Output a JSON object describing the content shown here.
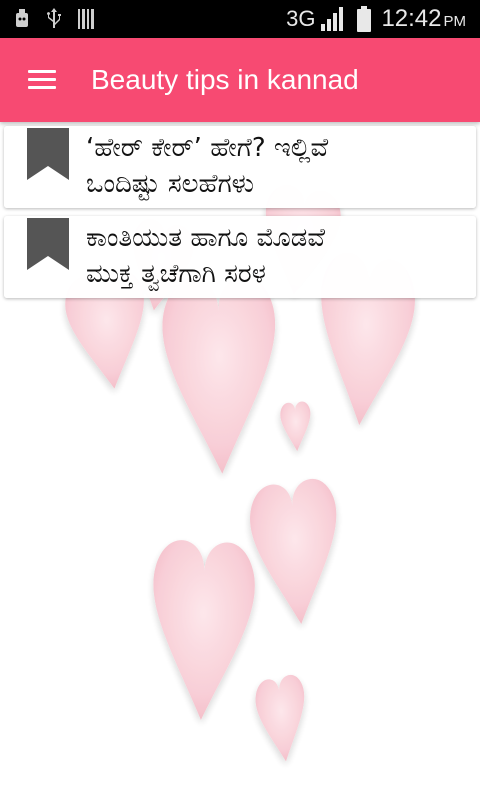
{
  "status_bar": {
    "network": "3G",
    "time": "12:42",
    "ampm": "PM",
    "icons": [
      "robot-notification-icon",
      "usb-icon",
      "barcode-icon",
      "signal-icon",
      "battery-icon"
    ]
  },
  "toolbar": {
    "title": "Beauty tips in kannad",
    "background": "#f74a72"
  },
  "list": {
    "items": [
      {
        "line1": "‘ಹೇರ್ ಕೇರ್’ ಹೇಗೆ? ಇಲ್ಲಿವೆ",
        "line2": "ಒಂದಿಷ್ಟು ಸಲಹೆಗಳು"
      },
      {
        "line1": "ಕಾಂತಿಯುತ ಹಾಗೂ ಮೊಡವೆ",
        "line2": "ಮುಕ್ತ ತ್ವಚೆಗಾಗಿ ಸರಳ"
      }
    ]
  },
  "colors": {
    "accent": "#f74a72",
    "heart": "#f7c8d2",
    "bookmark": "#555555"
  }
}
